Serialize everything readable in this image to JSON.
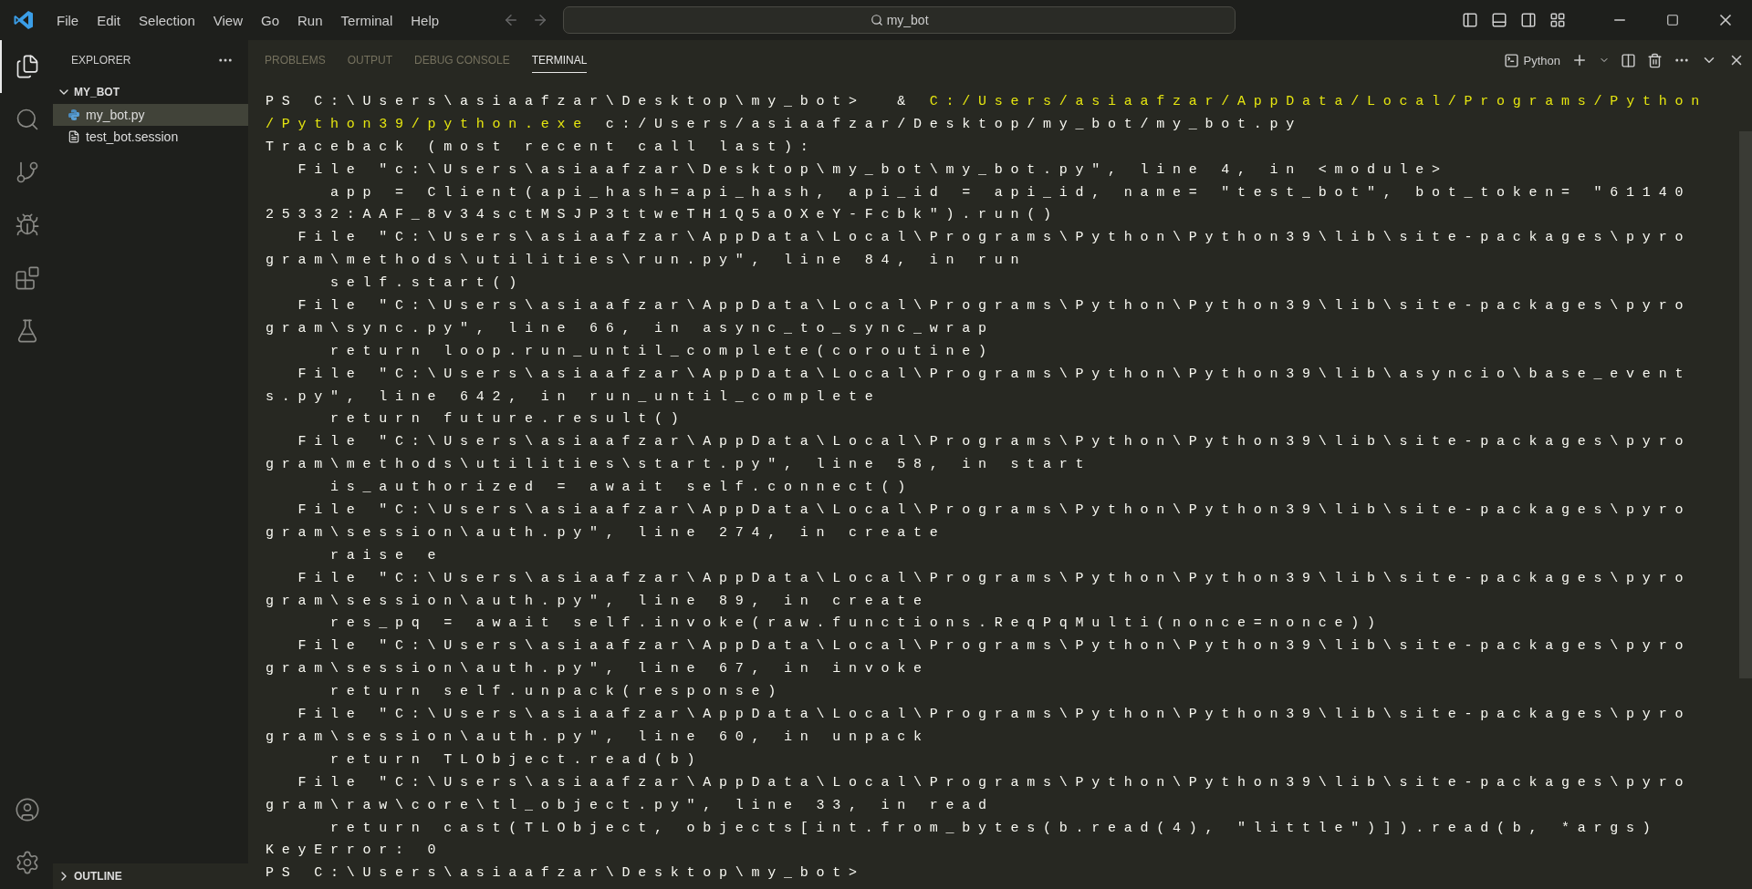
{
  "title_bar": {
    "menu": [
      "File",
      "Edit",
      "Selection",
      "View",
      "Go",
      "Run",
      "Terminal",
      "Help"
    ],
    "search": "my_bot"
  },
  "activity_bar": {
    "items": [
      {
        "kind": "explorer",
        "selected": true
      },
      {
        "kind": "search",
        "selected": false
      },
      {
        "kind": "source-control",
        "selected": false
      },
      {
        "kind": "run",
        "selected": false
      },
      {
        "kind": "extensions",
        "selected": false
      },
      {
        "kind": "testing",
        "selected": false
      }
    ],
    "bottom": [
      {
        "kind": "account"
      },
      {
        "kind": "settings"
      }
    ]
  },
  "sidebar": {
    "title": "EXPLORER",
    "folder": {
      "name": "MY_BOT",
      "expanded": true,
      "files": [
        {
          "name": "my_bot.py",
          "kind": "python",
          "selected": true
        },
        {
          "name": "test_bot.session",
          "kind": "text",
          "selected": false
        }
      ]
    },
    "outline": {
      "name": "OUTLINE",
      "expanded": false
    }
  },
  "panel": {
    "tabs": [
      {
        "label": "PROBLEMS",
        "selected": false
      },
      {
        "label": "OUTPUT",
        "selected": false
      },
      {
        "label": "DEBUG CONSOLE",
        "selected": false
      },
      {
        "label": "TERMINAL",
        "selected": true
      }
    ],
    "terminal_name": "Python",
    "lines": [
      [
        {
          "text": "PS C:\\Users\\asiaafzar\\Desktop\\my_bot>  & ",
          "kind": "plain"
        },
        {
          "text": "C:/Users/asiaafzar/AppData/Local/Programs/Python",
          "kind": "command"
        }
      ],
      [
        {
          "text": "/Python39/python.exe",
          "kind": "command"
        },
        {
          "text": " c:/Users/asiaafzar/Desktop/my_bot/my_bot.py",
          "kind": "plain"
        }
      ],
      [
        {
          "text": "Traceback (most recent call last):",
          "kind": "plain"
        }
      ],
      [
        {
          "text": "  File \"c:\\Users\\asiaafzar\\Desktop\\my_bot\\my_bot.py\", line 4, in <module>",
          "kind": "plain"
        }
      ],
      [
        {
          "text": "    app = Client(api_hash=api_hash, api_id = api_id, name= \"test_bot\", bot_token= \"61140",
          "kind": "plain"
        }
      ],
      [
        {
          "text": "25332:AAF_8v34sctMSJP3ttweTH1Q5aOXeY-Fcbk\").run()",
          "kind": "plain"
        }
      ],
      [
        {
          "text": "  File \"C:\\Users\\asiaafzar\\AppData\\Local\\Programs\\Python\\Python39\\lib\\site-packages\\pyro",
          "kind": "plain"
        }
      ],
      [
        {
          "text": "gram\\methods\\utilities\\run.py\", line 84, in run",
          "kind": "plain"
        }
      ],
      [
        {
          "text": "    self.start()",
          "kind": "plain"
        }
      ],
      [
        {
          "text": "  File \"C:\\Users\\asiaafzar\\AppData\\Local\\Programs\\Python\\Python39\\lib\\site-packages\\pyro",
          "kind": "plain"
        }
      ],
      [
        {
          "text": "gram\\sync.py\", line 66, in async_to_sync_wrap",
          "kind": "plain"
        }
      ],
      [
        {
          "text": "    return loop.run_until_complete(coroutine)",
          "kind": "plain"
        }
      ],
      [
        {
          "text": "  File \"C:\\Users\\asiaafzar\\AppData\\Local\\Programs\\Python\\Python39\\lib\\asyncio\\base_event",
          "kind": "plain"
        }
      ],
      [
        {
          "text": "s.py\", line 642, in run_until_complete",
          "kind": "plain"
        }
      ],
      [
        {
          "text": "    return future.result()",
          "kind": "plain"
        }
      ],
      [
        {
          "text": "  File \"C:\\Users\\asiaafzar\\AppData\\Local\\Programs\\Python\\Python39\\lib\\site-packages\\pyro",
          "kind": "plain"
        }
      ],
      [
        {
          "text": "gram\\methods\\utilities\\start.py\", line 58, in start",
          "kind": "plain"
        }
      ],
      [
        {
          "text": "    is_authorized = await self.connect()",
          "kind": "plain"
        }
      ],
      [
        {
          "text": "  File \"C:\\Users\\asiaafzar\\AppData\\Local\\Programs\\Python\\Python39\\lib\\site-packages\\pyro",
          "kind": "plain"
        }
      ],
      [
        {
          "text": "gram\\session\\auth.py\", line 274, in create",
          "kind": "plain"
        }
      ],
      [
        {
          "text": "    raise e",
          "kind": "plain"
        }
      ],
      [
        {
          "text": "  File \"C:\\Users\\asiaafzar\\AppData\\Local\\Programs\\Python\\Python39\\lib\\site-packages\\pyro",
          "kind": "plain"
        }
      ],
      [
        {
          "text": "gram\\session\\auth.py\", line 89, in create",
          "kind": "plain"
        }
      ],
      [
        {
          "text": "    res_pq = await self.invoke(raw.functions.ReqPqMulti(nonce=nonce))",
          "kind": "plain"
        }
      ],
      [
        {
          "text": "  File \"C:\\Users\\asiaafzar\\AppData\\Local\\Programs\\Python\\Python39\\lib\\site-packages\\pyro",
          "kind": "plain"
        }
      ],
      [
        {
          "text": "gram\\session\\auth.py\", line 67, in invoke",
          "kind": "plain"
        }
      ],
      [
        {
          "text": "    return self.unpack(response)",
          "kind": "plain"
        }
      ],
      [
        {
          "text": "  File \"C:\\Users\\asiaafzar\\AppData\\Local\\Programs\\Python\\Python39\\lib\\site-packages\\pyro",
          "kind": "plain"
        }
      ],
      [
        {
          "text": "gram\\session\\auth.py\", line 60, in unpack",
          "kind": "plain"
        }
      ],
      [
        {
          "text": "    return TLObject.read(b)",
          "kind": "plain"
        }
      ],
      [
        {
          "text": "  File \"C:\\Users\\asiaafzar\\AppData\\Local\\Programs\\Python\\Python39\\lib\\site-packages\\pyro",
          "kind": "plain"
        }
      ],
      [
        {
          "text": "gram\\raw\\core\\tl_object.py\", line 33, in read",
          "kind": "plain"
        }
      ],
      [
        {
          "text": "    return cast(TLObject, objects[int.from_bytes(b.read(4), \"little\")]).read(b, *args)",
          "kind": "plain"
        }
      ],
      [
        {
          "text": "KeyError: 0",
          "kind": "plain"
        }
      ],
      [
        {
          "text": "PS C:\\Users\\asiaafzar\\Desktop\\my_bot>",
          "kind": "plain"
        }
      ]
    ]
  }
}
